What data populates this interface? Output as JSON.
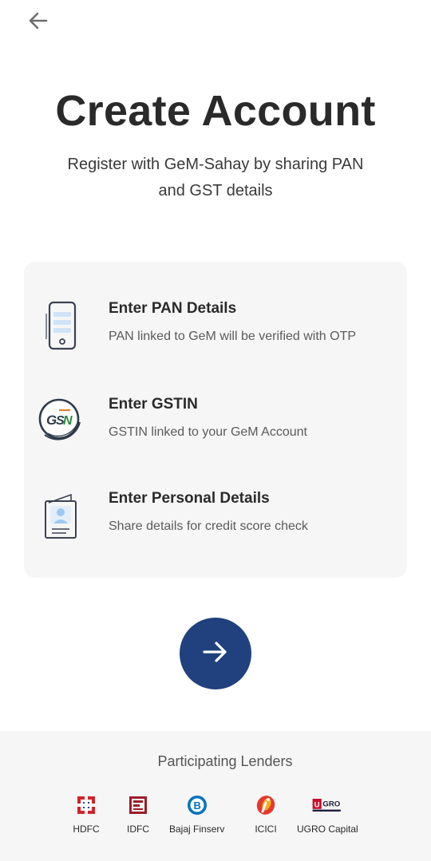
{
  "header": {
    "back_icon": "arrow-left-icon"
  },
  "title": "Create Account",
  "subtitle": "Register with GeM-Sahay by sharing PAN and GST details",
  "steps": [
    {
      "icon": "phone-icon",
      "title": "Enter PAN Details",
      "desc": "PAN linked to GeM will be verified with OTP"
    },
    {
      "icon": "gstin-logo-icon",
      "title": "Enter GSTIN",
      "desc": "GSTIN linked to your GeM Account",
      "logo_text": "GSTN"
    },
    {
      "icon": "id-card-icon",
      "title": "Enter Personal Details",
      "desc": "Share details for credit score check"
    }
  ],
  "next_button": {
    "icon": "arrow-right-icon",
    "color": "#20417d"
  },
  "lenders": {
    "title": "Participating Lenders",
    "items": [
      {
        "name": "HDFC",
        "icon": "hdfc-logo-icon",
        "color": "#d2232a"
      },
      {
        "name": "IDFC",
        "icon": "idfc-logo-icon",
        "color": "#9c1d26"
      },
      {
        "name": "Bajaj Finserv",
        "icon": "bajaj-finserv-logo-icon",
        "color": "#0072bc"
      },
      {
        "name": "ICICI",
        "icon": "icici-logo-icon",
        "color": "#e8372c"
      },
      {
        "name": "UGRO Capital",
        "icon": "ugro-capital-logo-icon",
        "color": "#c8102e",
        "logo_text": "U GRO"
      }
    ]
  }
}
